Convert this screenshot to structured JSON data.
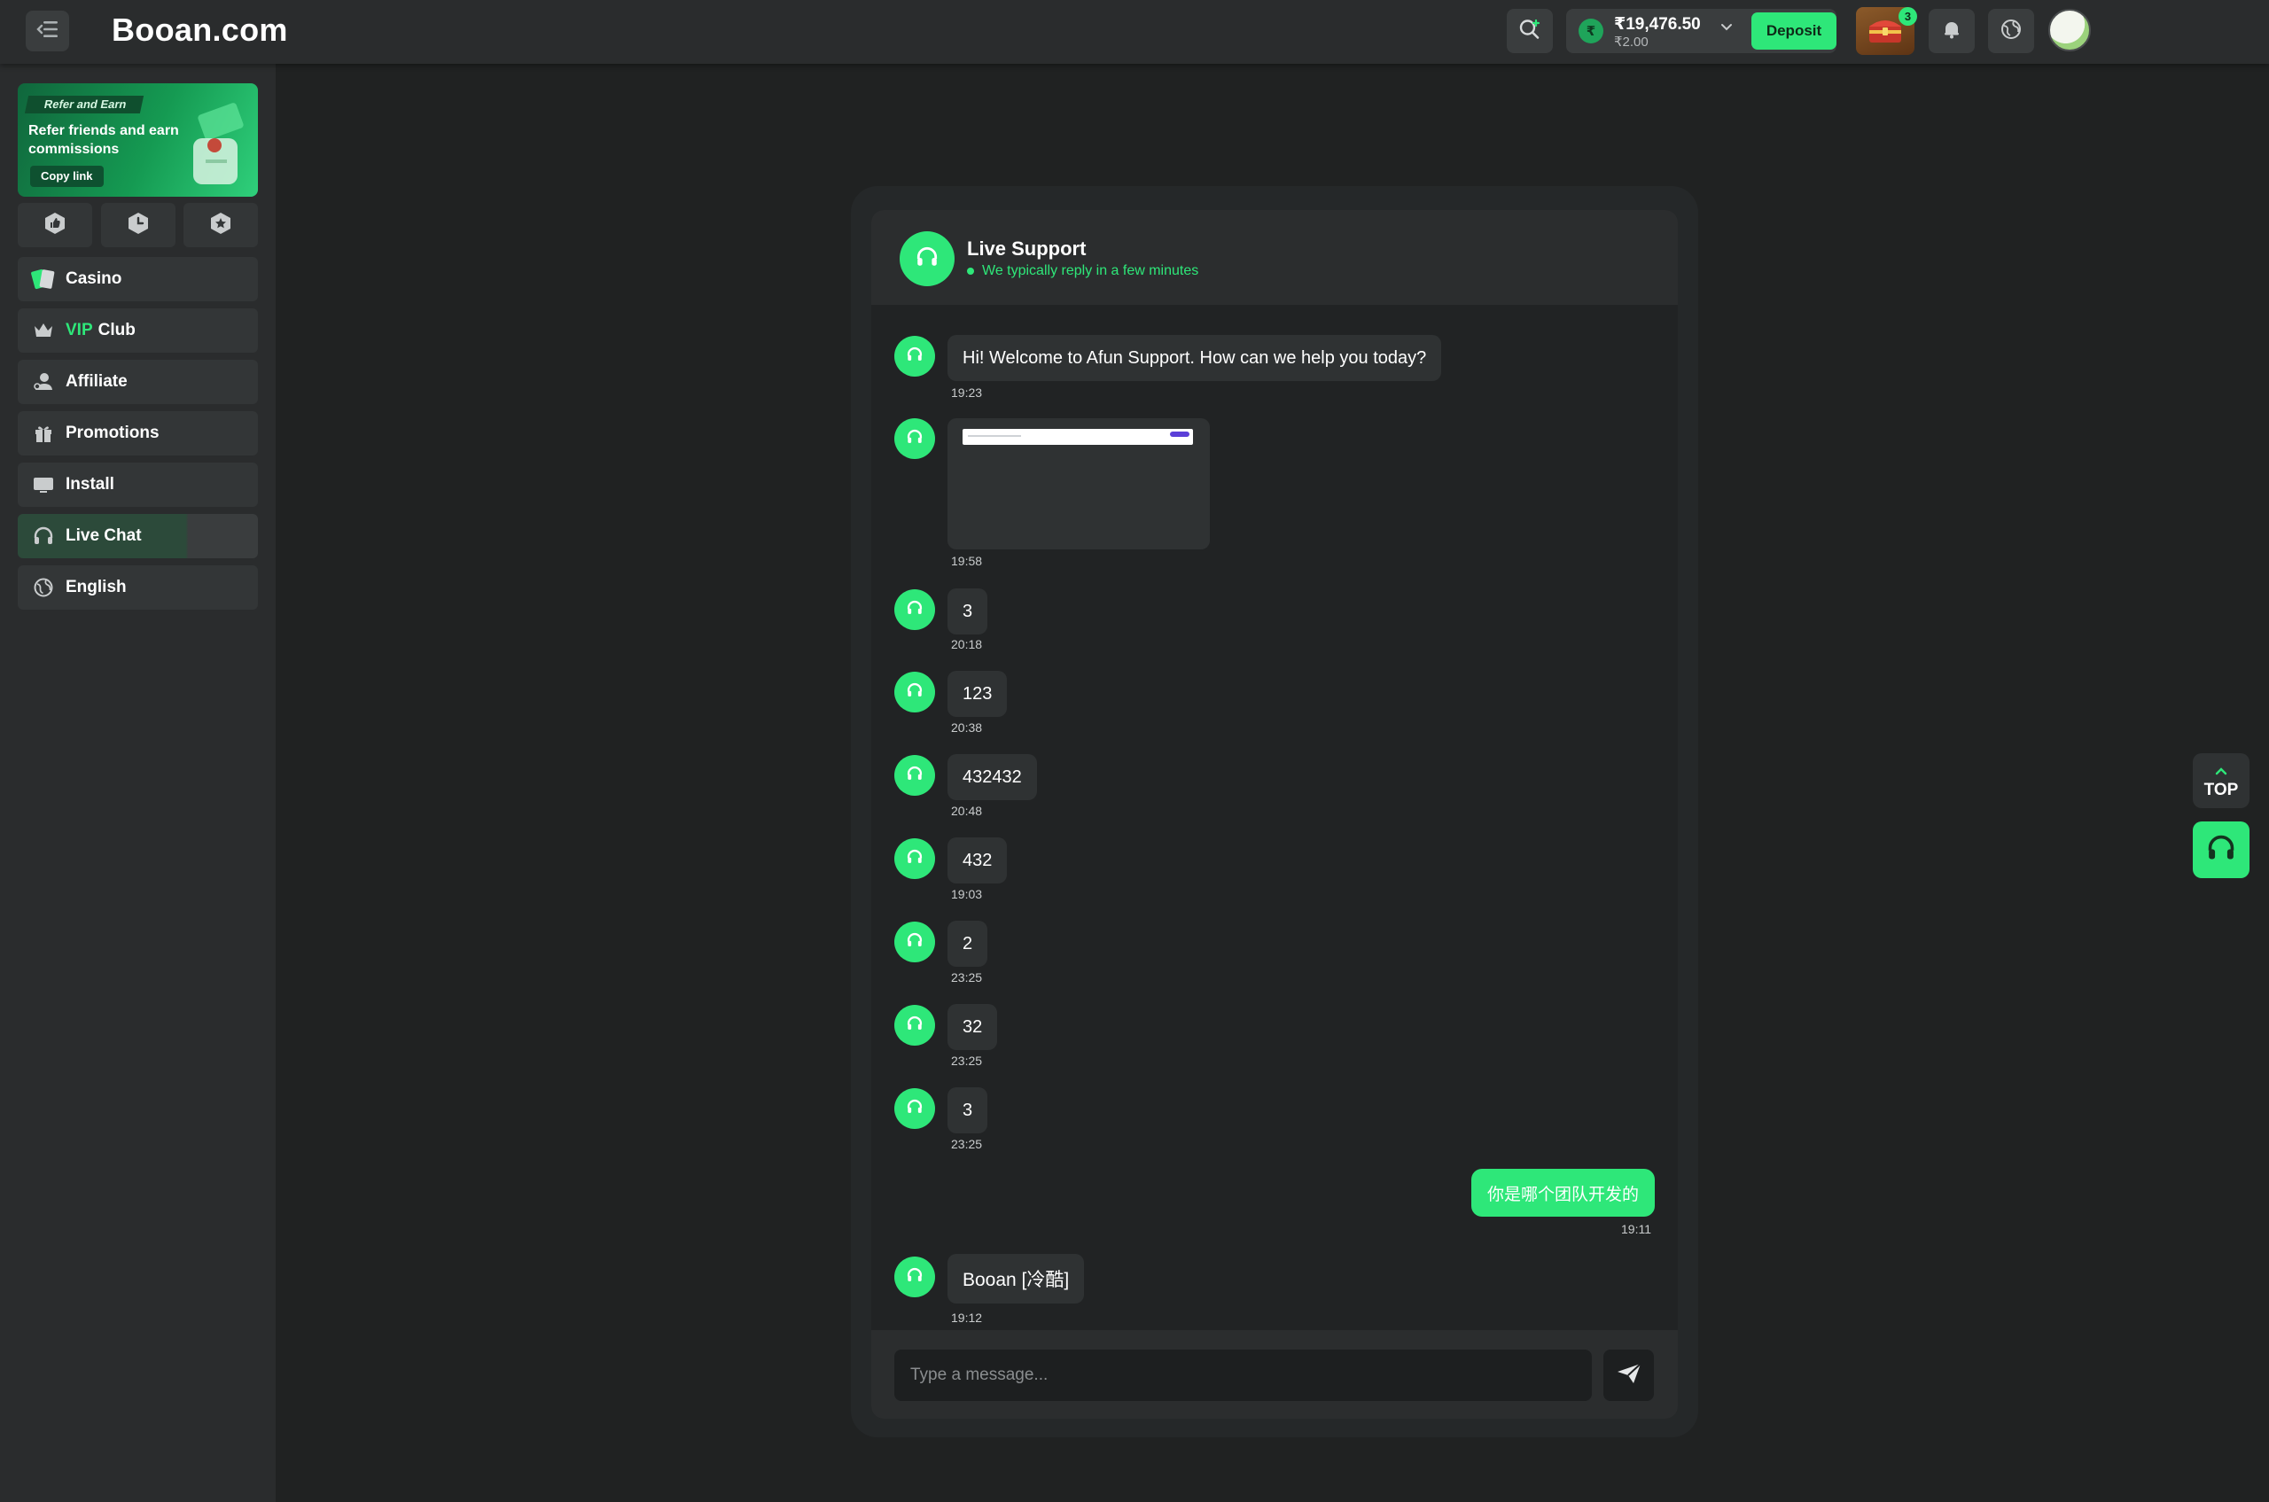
{
  "header": {
    "brand": "Booan.com",
    "balance_main": "₹19,476.50",
    "balance_sub": "₹2.00",
    "currency_symbol": "₹",
    "deposit_label": "Deposit",
    "chest_badge": "3"
  },
  "sidebar": {
    "promo": {
      "tag": "Refer and Earn",
      "title": "Refer friends and earn commissions",
      "copy_label": "Copy link"
    },
    "items": [
      {
        "label": "Casino"
      },
      {
        "label_accent": "VIP",
        "label": "Club"
      },
      {
        "label": "Affiliate"
      },
      {
        "label": "Promotions"
      },
      {
        "label": "Install"
      },
      {
        "label": "Live Chat"
      },
      {
        "label": "English"
      }
    ]
  },
  "chat": {
    "title": "Live Support",
    "subtitle": "We typically reply in a few minutes",
    "messages": [
      {
        "text": "Hi! Welcome to Afun Support. How can we help you today?",
        "time": "19:23"
      },
      {
        "text": "",
        "time": "19:58"
      },
      {
        "text": "3",
        "time": "20:18"
      },
      {
        "text": "123",
        "time": "20:38"
      },
      {
        "text": "432432",
        "time": "20:48"
      },
      {
        "text": "432",
        "time": "19:03"
      },
      {
        "text": "2",
        "time": "23:25"
      },
      {
        "text": "32",
        "time": "23:25"
      },
      {
        "text": "3",
        "time": "23:25"
      },
      {
        "text": "你是哪个团队开发的",
        "time": "19:11"
      },
      {
        "text": "Booan [冷酷]",
        "time": "19:12"
      }
    ],
    "input_placeholder": "Type a message..."
  },
  "floating": {
    "top_label": "TOP"
  },
  "colors": {
    "accent": "#2ee779",
    "background": "#202222",
    "panel": "#2a2c2d"
  }
}
